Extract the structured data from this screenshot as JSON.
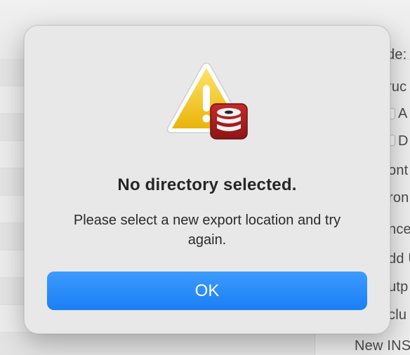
{
  "dialog": {
    "title": "No directory selected.",
    "message": "Please select a new export location and try again.",
    "ok_label": "OK"
  },
  "background_window": {
    "sidebar_fragments": [
      "de:",
      "ruc",
      "A",
      "D",
      "ont",
      "ron",
      "nce",
      "dd U",
      "utp",
      "clu",
      "New INS"
    ]
  },
  "colors": {
    "accent": "#1a7ff5",
    "warning_yellow": "#f3c316",
    "db_red": "#a71a1a"
  },
  "icons": {
    "alert": "warning-triangle-icon",
    "app_badge": "database-icon"
  }
}
